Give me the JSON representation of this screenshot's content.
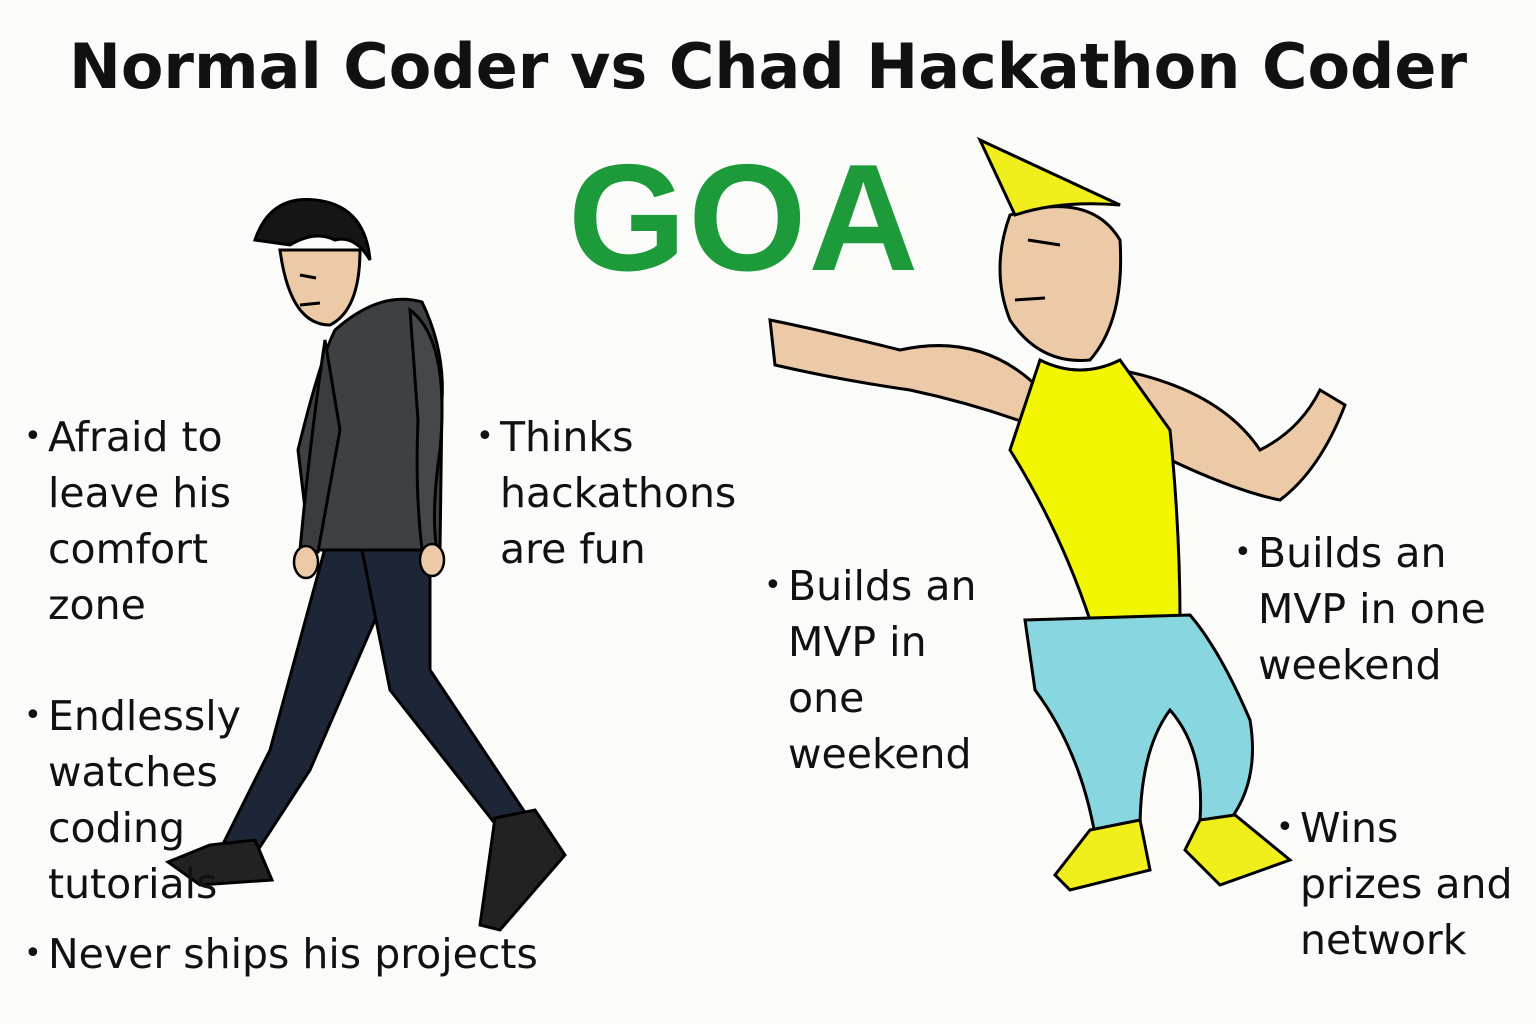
{
  "title": "Normal Coder vs Chad Hackathon Coder",
  "logo_text": "GOA",
  "colors": {
    "goa_green": "#1d9a3a",
    "hoodie": "#3e4143",
    "jeans": "#1c2636",
    "skin": "#ecc9a7",
    "tank_top": "#f2f600",
    "pants": "#88d6df",
    "boots": "#f0ef1c"
  },
  "left_bullets": {
    "comfort": "Afraid to leave his comfort zone",
    "tutorials": "Endlessly watches coding tutorials",
    "fun": "Thinks hackathons are fun",
    "ships": "Never ships his projects"
  },
  "right_bullets": {
    "mvp_a": "Builds an MVP in one weekend",
    "mvp_b": "Builds an MVP in one weekend",
    "prizes": "Wins prizes and network"
  },
  "icons": {
    "bullet": "•"
  }
}
